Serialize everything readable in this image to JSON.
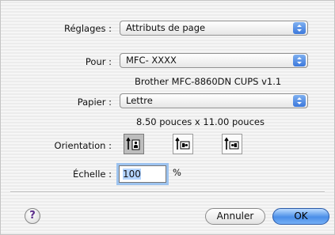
{
  "settings": {
    "label": "Réglages :",
    "value": "Attributs de page"
  },
  "pour": {
    "label": "Pour :",
    "value": "MFC- XXXX",
    "info": "Brother MFC-8860DN CUPS v1.1"
  },
  "papier": {
    "label": "Papier :",
    "value": "Lettre",
    "info": "8.50 pouces x 11.00 pouces"
  },
  "orientation": {
    "label": "Orientation :",
    "options": [
      "portrait",
      "landscape",
      "landscape-reversed"
    ],
    "selected": "portrait"
  },
  "scale": {
    "label": "Échelle :",
    "value": "100",
    "unit": "%"
  },
  "buttons": {
    "help": "?",
    "cancel": "Annuler",
    "ok": "OK"
  },
  "colors": {
    "accent": "#4a8ee8",
    "focus_ring": "#9dc3ef"
  }
}
